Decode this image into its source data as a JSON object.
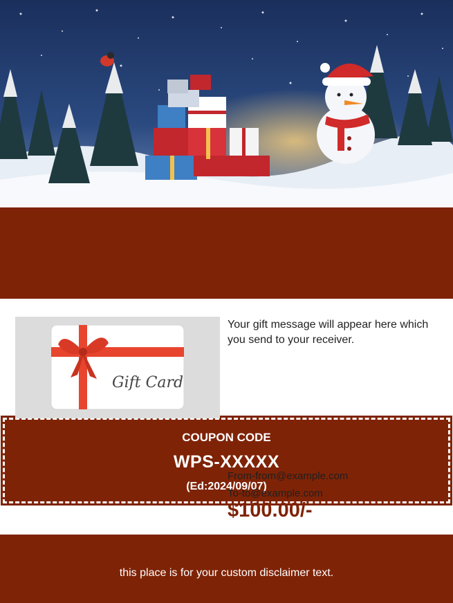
{
  "coupon": {
    "title": "COUPON CODE",
    "code": "WPS-XXXXX",
    "expiry": "(Ed:2024/09/07)"
  },
  "gift_card": {
    "script_text": "Gift Card"
  },
  "message": {
    "text": "Your gift message will appear here which you send to your receiver."
  },
  "sender": {
    "from": "From-from@example.com",
    "to": "To-to@example.com"
  },
  "amount": "$100.00/-",
  "footer": {
    "disclaimer": "this place is for your custom disclaimer text."
  },
  "colors": {
    "brand": "#7f2306",
    "sky": "#1f3a6b",
    "snow": "#f2f5fa"
  }
}
